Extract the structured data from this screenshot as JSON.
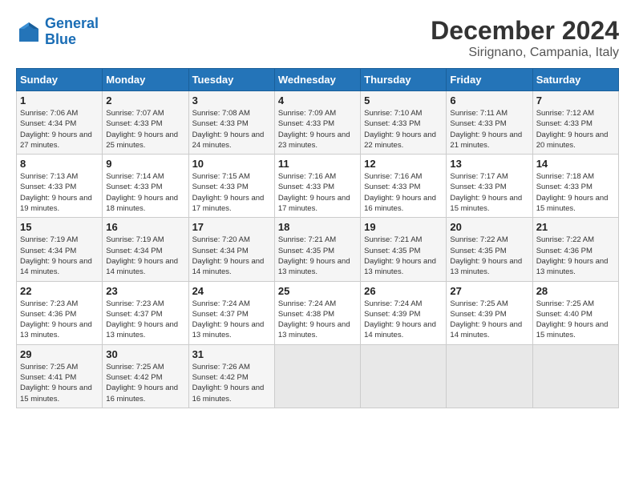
{
  "header": {
    "logo_line1": "General",
    "logo_line2": "Blue",
    "title": "December 2024",
    "subtitle": "Sirignano, Campania, Italy"
  },
  "weekdays": [
    "Sunday",
    "Monday",
    "Tuesday",
    "Wednesday",
    "Thursday",
    "Friday",
    "Saturday"
  ],
  "weeks": [
    [
      {
        "day": "1",
        "sunrise": "7:06 AM",
        "sunset": "4:34 PM",
        "daylight": "9 hours and 27 minutes."
      },
      {
        "day": "2",
        "sunrise": "7:07 AM",
        "sunset": "4:33 PM",
        "daylight": "9 hours and 25 minutes."
      },
      {
        "day": "3",
        "sunrise": "7:08 AM",
        "sunset": "4:33 PM",
        "daylight": "9 hours and 24 minutes."
      },
      {
        "day": "4",
        "sunrise": "7:09 AM",
        "sunset": "4:33 PM",
        "daylight": "9 hours and 23 minutes."
      },
      {
        "day": "5",
        "sunrise": "7:10 AM",
        "sunset": "4:33 PM",
        "daylight": "9 hours and 22 minutes."
      },
      {
        "day": "6",
        "sunrise": "7:11 AM",
        "sunset": "4:33 PM",
        "daylight": "9 hours and 21 minutes."
      },
      {
        "day": "7",
        "sunrise": "7:12 AM",
        "sunset": "4:33 PM",
        "daylight": "9 hours and 20 minutes."
      }
    ],
    [
      {
        "day": "8",
        "sunrise": "7:13 AM",
        "sunset": "4:33 PM",
        "daylight": "9 hours and 19 minutes."
      },
      {
        "day": "9",
        "sunrise": "7:14 AM",
        "sunset": "4:33 PM",
        "daylight": "9 hours and 18 minutes."
      },
      {
        "day": "10",
        "sunrise": "7:15 AM",
        "sunset": "4:33 PM",
        "daylight": "9 hours and 17 minutes."
      },
      {
        "day": "11",
        "sunrise": "7:16 AM",
        "sunset": "4:33 PM",
        "daylight": "9 hours and 17 minutes."
      },
      {
        "day": "12",
        "sunrise": "7:16 AM",
        "sunset": "4:33 PM",
        "daylight": "9 hours and 16 minutes."
      },
      {
        "day": "13",
        "sunrise": "7:17 AM",
        "sunset": "4:33 PM",
        "daylight": "9 hours and 15 minutes."
      },
      {
        "day": "14",
        "sunrise": "7:18 AM",
        "sunset": "4:33 PM",
        "daylight": "9 hours and 15 minutes."
      }
    ],
    [
      {
        "day": "15",
        "sunrise": "7:19 AM",
        "sunset": "4:34 PM",
        "daylight": "9 hours and 14 minutes."
      },
      {
        "day": "16",
        "sunrise": "7:19 AM",
        "sunset": "4:34 PM",
        "daylight": "9 hours and 14 minutes."
      },
      {
        "day": "17",
        "sunrise": "7:20 AM",
        "sunset": "4:34 PM",
        "daylight": "9 hours and 14 minutes."
      },
      {
        "day": "18",
        "sunrise": "7:21 AM",
        "sunset": "4:35 PM",
        "daylight": "9 hours and 13 minutes."
      },
      {
        "day": "19",
        "sunrise": "7:21 AM",
        "sunset": "4:35 PM",
        "daylight": "9 hours and 13 minutes."
      },
      {
        "day": "20",
        "sunrise": "7:22 AM",
        "sunset": "4:35 PM",
        "daylight": "9 hours and 13 minutes."
      },
      {
        "day": "21",
        "sunrise": "7:22 AM",
        "sunset": "4:36 PM",
        "daylight": "9 hours and 13 minutes."
      }
    ],
    [
      {
        "day": "22",
        "sunrise": "7:23 AM",
        "sunset": "4:36 PM",
        "daylight": "9 hours and 13 minutes."
      },
      {
        "day": "23",
        "sunrise": "7:23 AM",
        "sunset": "4:37 PM",
        "daylight": "9 hours and 13 minutes."
      },
      {
        "day": "24",
        "sunrise": "7:24 AM",
        "sunset": "4:37 PM",
        "daylight": "9 hours and 13 minutes."
      },
      {
        "day": "25",
        "sunrise": "7:24 AM",
        "sunset": "4:38 PM",
        "daylight": "9 hours and 13 minutes."
      },
      {
        "day": "26",
        "sunrise": "7:24 AM",
        "sunset": "4:39 PM",
        "daylight": "9 hours and 14 minutes."
      },
      {
        "day": "27",
        "sunrise": "7:25 AM",
        "sunset": "4:39 PM",
        "daylight": "9 hours and 14 minutes."
      },
      {
        "day": "28",
        "sunrise": "7:25 AM",
        "sunset": "4:40 PM",
        "daylight": "9 hours and 15 minutes."
      }
    ],
    [
      {
        "day": "29",
        "sunrise": "7:25 AM",
        "sunset": "4:41 PM",
        "daylight": "9 hours and 15 minutes."
      },
      {
        "day": "30",
        "sunrise": "7:25 AM",
        "sunset": "4:42 PM",
        "daylight": "9 hours and 16 minutes."
      },
      {
        "day": "31",
        "sunrise": "7:26 AM",
        "sunset": "4:42 PM",
        "daylight": "9 hours and 16 minutes."
      },
      null,
      null,
      null,
      null
    ]
  ]
}
